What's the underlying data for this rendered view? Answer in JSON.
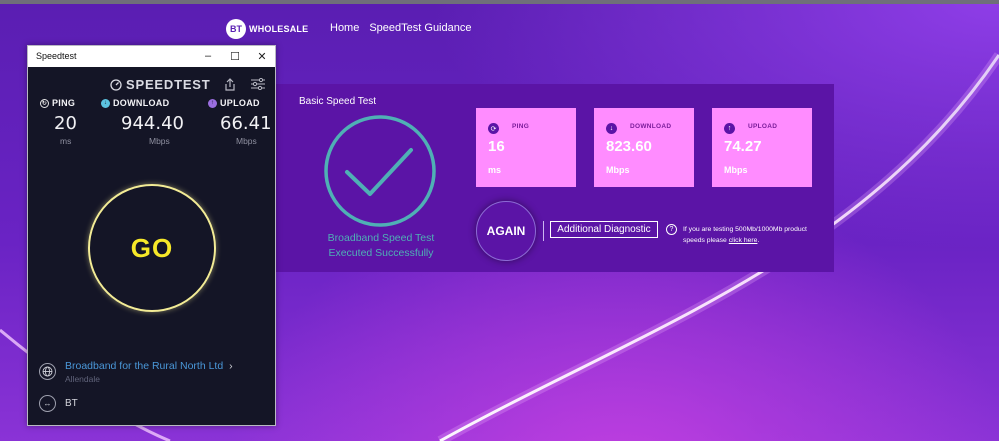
{
  "speedtest_window": {
    "window_title": "Speedtest",
    "logo_text": "SPEEDTEST",
    "ping": {
      "label": "PING",
      "value": "20",
      "unit": "ms"
    },
    "download": {
      "label": "DOWNLOAD",
      "value": "944.40",
      "unit": "Mbps"
    },
    "upload": {
      "label": "UPLOAD",
      "value": "66.41",
      "unit": "Mbps"
    },
    "go_label": "GO",
    "isp": {
      "name": "Broadband for the Rural North Ltd",
      "location": "Allendale"
    },
    "server": {
      "name": "BT"
    },
    "colors": {
      "go": "#f6e829",
      "ping_icon": "#e6e6e6",
      "download_icon": "#5cc3e0",
      "upload_icon": "#9b6ee0",
      "isp_link": "#4a97d8"
    }
  },
  "bt_page": {
    "logo_circle": "BT",
    "logo_text": "WHOLESALE",
    "nav": [
      "Home",
      "SpeedTest Guidance"
    ],
    "panel_title": "Basic Speed Test",
    "status_line1": "Broadband Speed Test",
    "status_line2": "Executed Successfully",
    "metrics": [
      {
        "label": "PING",
        "value": "16",
        "unit": "ms",
        "icon": "ping-icon"
      },
      {
        "label": "DOWNLOAD",
        "value": "823.60",
        "unit": "Mbps",
        "icon": "download-icon"
      },
      {
        "label": "UPLOAD",
        "value": "74.27",
        "unit": "Mbps",
        "icon": "upload-icon"
      }
    ],
    "again_label": "AGAIN",
    "diagnostic_label": "Additional Diagnostic",
    "help_text": "If you are testing 500Mb/1000Mb product speeds please",
    "help_link": "click here",
    "colors": {
      "panel": "#5b14a6",
      "metric_box": "#ff8cff",
      "check": "#4fb0b5"
    }
  }
}
